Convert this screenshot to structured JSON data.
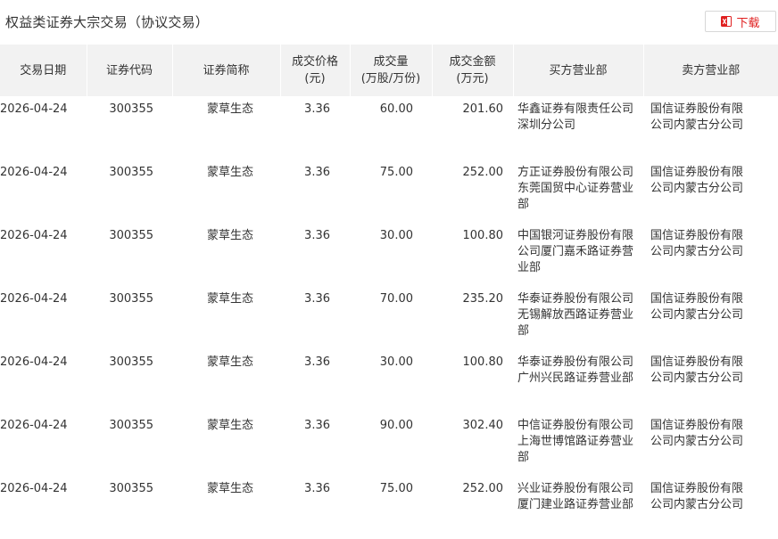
{
  "page": {
    "title": "权益类证券大宗交易（协议交易）",
    "download_label": "下载",
    "download_icon": "excel-icon",
    "accent_color": "#e02020",
    "header_bg": "#f2f2f2"
  },
  "table": {
    "headers": {
      "date": "交易日期",
      "code": "证券代码",
      "name": "证券简称",
      "price": [
        "成交价格",
        "(元)"
      ],
      "volume": [
        "成交量",
        "(万股/万份)"
      ],
      "amount": [
        "成交金额",
        "(万元)"
      ],
      "buyer": "买方营业部",
      "seller": "卖方营业部"
    },
    "rows": [
      {
        "date": "2026-04-24",
        "code": "300355",
        "name": "蒙草生态",
        "price": "3.36",
        "volume": "60.00",
        "amount": "201.60",
        "buyer": "华鑫证券有限责任公司深圳分公司",
        "seller": "国信证券股份有限公司内蒙古分公司"
      },
      {
        "date": "2026-04-24",
        "code": "300355",
        "name": "蒙草生态",
        "price": "3.36",
        "volume": "75.00",
        "amount": "252.00",
        "buyer": "方正证券股份有限公司东莞国贸中心证券营业部",
        "seller": "国信证券股份有限公司内蒙古分公司"
      },
      {
        "date": "2026-04-24",
        "code": "300355",
        "name": "蒙草生态",
        "price": "3.36",
        "volume": "30.00",
        "amount": "100.80",
        "buyer": "中国银河证券股份有限公司厦门嘉禾路证券营业部",
        "seller": "国信证券股份有限公司内蒙古分公司"
      },
      {
        "date": "2026-04-24",
        "code": "300355",
        "name": "蒙草生态",
        "price": "3.36",
        "volume": "70.00",
        "amount": "235.20",
        "buyer": "华泰证券股份有限公司无锡解放西路证券营业部",
        "seller": "国信证券股份有限公司内蒙古分公司"
      },
      {
        "date": "2026-04-24",
        "code": "300355",
        "name": "蒙草生态",
        "price": "3.36",
        "volume": "30.00",
        "amount": "100.80",
        "buyer": "华泰证券股份有限公司广州兴民路证券营业部",
        "seller": "国信证券股份有限公司内蒙古分公司"
      },
      {
        "date": "2026-04-24",
        "code": "300355",
        "name": "蒙草生态",
        "price": "3.36",
        "volume": "90.00",
        "amount": "302.40",
        "buyer": "中信证券股份有限公司上海世博馆路证券营业部",
        "seller": "国信证券股份有限公司内蒙古分公司"
      },
      {
        "date": "2026-04-24",
        "code": "300355",
        "name": "蒙草生态",
        "price": "3.36",
        "volume": "75.00",
        "amount": "252.00",
        "buyer": "兴业证券股份有限公司厦门建业路证券营业部",
        "seller": "国信证券股份有限公司内蒙古分公司"
      }
    ]
  }
}
